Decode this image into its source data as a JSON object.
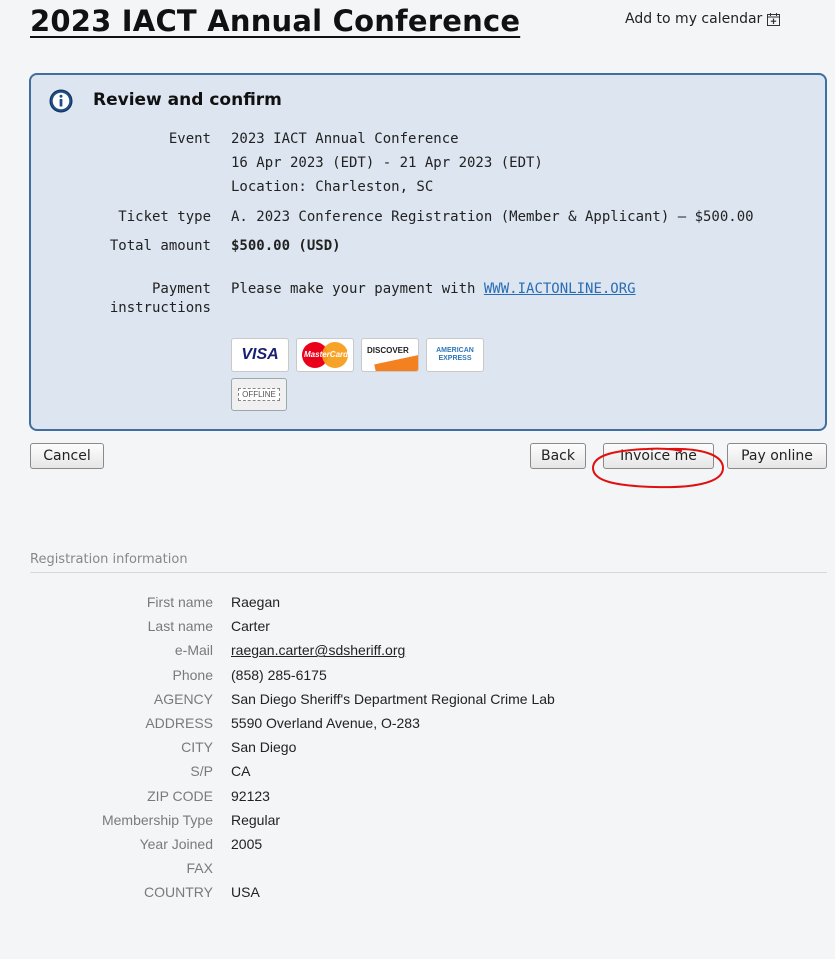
{
  "page": {
    "title": "2023 IACT Annual Conference",
    "calendar_link": "Add to my calendar"
  },
  "review": {
    "heading": "Review and confirm",
    "event_label": "Event",
    "event_name": "2023 IACT Annual Conference",
    "event_dates": "16 Apr 2023 (EDT) - 21 Apr 2023 (EDT)",
    "event_location": "Location: Charleston, SC",
    "ticket_label": "Ticket type",
    "ticket_value": "A. 2023 Conference Registration (Member & Applicant) – $500.00",
    "total_label": "Total amount",
    "total_value": "$500.00 (USD)",
    "payment_label_line1": "Payment",
    "payment_label_line2": "instructions",
    "payment_text": "Please make your payment with ",
    "payment_link": "WWW.IACTONLINE.ORG",
    "cards": {
      "visa": "VISA",
      "mastercard": "MasterCard",
      "discover": "DISCOVER",
      "amex_line1": "AMERICAN",
      "amex_line2": "EXPRESS",
      "offline": "OFFLINE"
    }
  },
  "actions": {
    "cancel": "Cancel",
    "back": "Back",
    "invoice": "Invoice me",
    "pay_online": "Pay online"
  },
  "registration": {
    "section_title": "Registration information",
    "fields": [
      {
        "label": "First name",
        "value": "Raegan"
      },
      {
        "label": "Last name",
        "value": "Carter"
      },
      {
        "label": "e-Mail",
        "value": "raegan.carter@sdsheriff.org"
      },
      {
        "label": "Phone",
        "value": "(858) 285-6175"
      },
      {
        "label": "AGENCY",
        "value": "San Diego Sheriff's Department Regional Crime Lab"
      },
      {
        "label": "ADDRESS",
        "value": "5590 Overland Avenue, O-283"
      },
      {
        "label": "CITY",
        "value": "San Diego"
      },
      {
        "label": "S/P",
        "value": "CA"
      },
      {
        "label": "ZIP CODE",
        "value": "92123"
      },
      {
        "label": "Membership Type",
        "value": "Regular"
      },
      {
        "label": "Year Joined",
        "value": "2005"
      },
      {
        "label": "FAX",
        "value": ""
      },
      {
        "label": "COUNTRY",
        "value": "USA"
      }
    ]
  },
  "colors": {
    "review_bg": "#dce5f0",
    "review_border": "#3f6ea0",
    "link": "#2a6db4",
    "annotation": "#e01010"
  }
}
